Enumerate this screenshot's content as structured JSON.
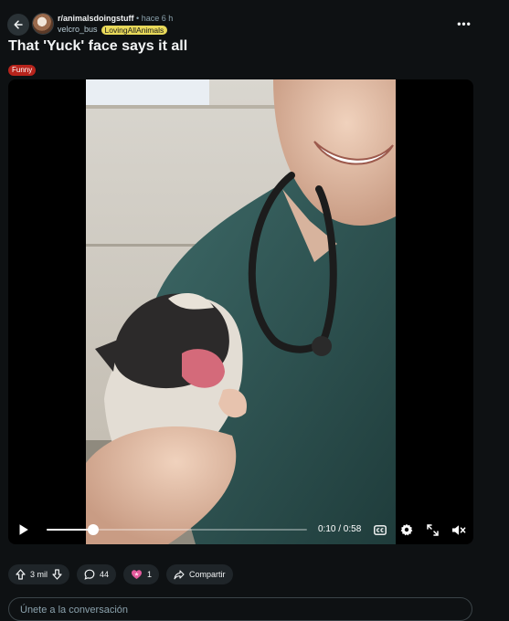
{
  "header": {
    "subreddit": "r/animalsdoingstuff",
    "separator": "•",
    "time_ago": "hace 6 h",
    "username": "velcro_bus",
    "user_flair": "LovingAllAnimals",
    "more_label": "•••"
  },
  "post": {
    "title": "That 'Yuck' face says it all",
    "flair": "Funny"
  },
  "video": {
    "current_time": "0:10",
    "duration": "0:58",
    "time_display": "0:10 / 0:58",
    "progress_fraction": 0.18,
    "muted": true,
    "captions_available": true
  },
  "actions": {
    "vote_count": "3 mil",
    "comment_count": "44",
    "award_count": "1",
    "share_label": "Compartir"
  },
  "comment": {
    "placeholder": "Únete a la conversación"
  },
  "colors": {
    "background": "#0e1113",
    "user_flair_bg": "#e8d95a",
    "post_flair_bg": "#b7241c",
    "pill_bg": "#1f2529"
  },
  "icons": {
    "back": "arrow-left-icon",
    "more": "more-horizontal-icon",
    "play": "play-icon",
    "captions": "closed-captions-icon",
    "settings": "gear-icon",
    "fullscreen": "expand-icon",
    "volume": "volume-muted-icon",
    "upvote": "arrow-up-icon",
    "downvote": "arrow-down-icon",
    "comment": "speech-bubble-icon",
    "award": "award-icon",
    "share": "share-arrow-icon"
  }
}
